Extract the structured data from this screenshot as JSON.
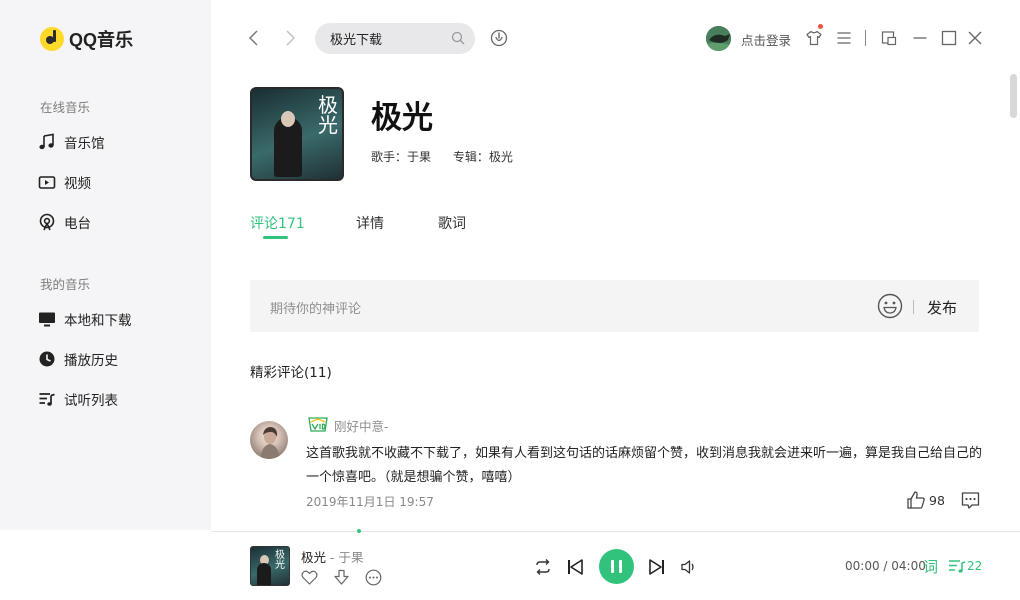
{
  "app": {
    "name": "QQ音乐",
    "accent": "#31c27c"
  },
  "sidebar": {
    "online_title": "在线音乐",
    "online_items": [
      {
        "label": "音乐馆",
        "icon": "music-note-icon"
      },
      {
        "label": "视频",
        "icon": "video-icon"
      },
      {
        "label": "电台",
        "icon": "radio-icon"
      }
    ],
    "my_title": "我的音乐",
    "my_items": [
      {
        "label": "本地和下载",
        "icon": "monitor-icon"
      },
      {
        "label": "播放历史",
        "icon": "clock-icon"
      },
      {
        "label": "试听列表",
        "icon": "playlist-icon"
      }
    ]
  },
  "header": {
    "search_value": "极光下载",
    "login_label": "点击登录"
  },
  "song": {
    "title": "极光",
    "singer": "歌手：于果",
    "album": "专辑：极光",
    "cover_text": "极光"
  },
  "tabs": [
    {
      "label": "评论171",
      "active": true
    },
    {
      "label": "详情",
      "active": false
    },
    {
      "label": "歌词",
      "active": false
    }
  ],
  "comment_box": {
    "placeholder": "期待你的神评论",
    "publish_label": "发布"
  },
  "hot_comments_title": "精彩评论(11)",
  "comments": [
    {
      "user": "刚好中意-",
      "text": "这首歌我就不收藏不下载了，如果有人看到这句话的话麻烦留个赞，收到消息我就会进来听一遍，算是我自己给自己的一个惊喜吧。（就是想骗个赞，嘻嘻）",
      "date": "2019年11月1日 19:57",
      "likes": "98"
    }
  ],
  "player": {
    "title": "极光",
    "separator": " - ",
    "artist": "于果",
    "time": "00:00 / 04:00",
    "lyric_label": "词",
    "playlist_count": "22"
  }
}
